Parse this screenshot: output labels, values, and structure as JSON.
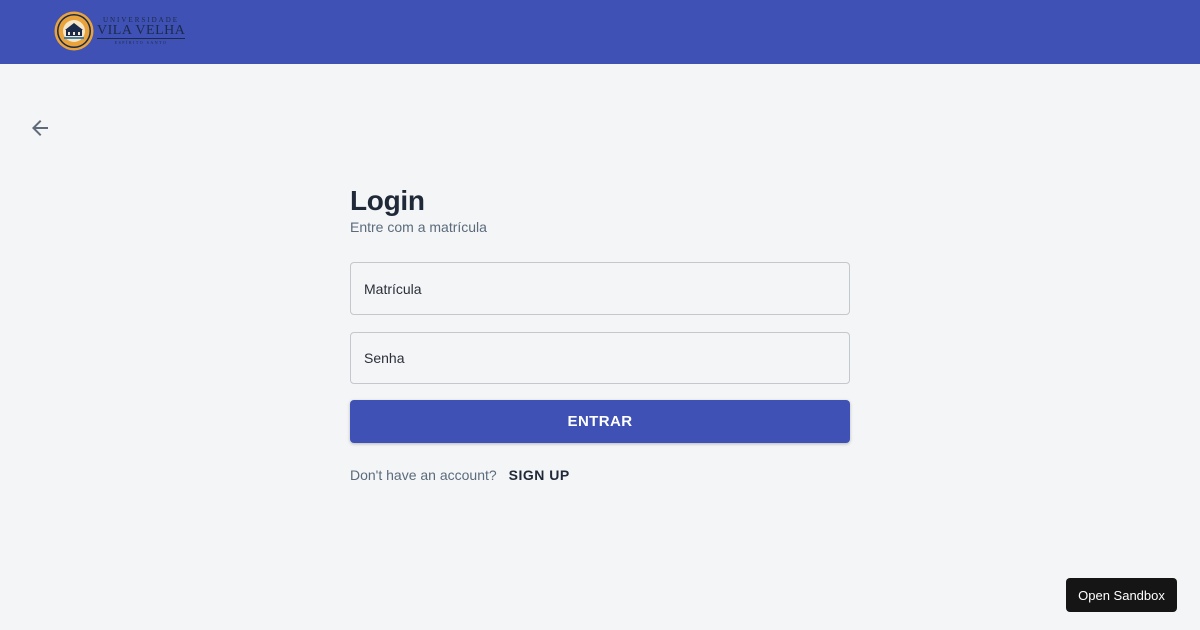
{
  "header": {
    "logo": {
      "line1": "UNIVERSIDADE",
      "line2": "VILA VELHA",
      "line3": "ESPÍRITO SANTO"
    },
    "background_color": "#3f51b5"
  },
  "back_button": {
    "icon": "arrow-left-icon"
  },
  "login": {
    "title": "Login",
    "subtitle": "Entre com a matrícula",
    "fields": [
      {
        "placeholder": "Matrícula",
        "value": ""
      },
      {
        "placeholder": "Senha",
        "value": ""
      }
    ],
    "submit_label": "ENTRAR",
    "submit_color": "#3f51b5",
    "signup_question": "Don't have an account?",
    "signup_link": "SIGN UP"
  },
  "sandbox": {
    "label": "Open Sandbox"
  }
}
